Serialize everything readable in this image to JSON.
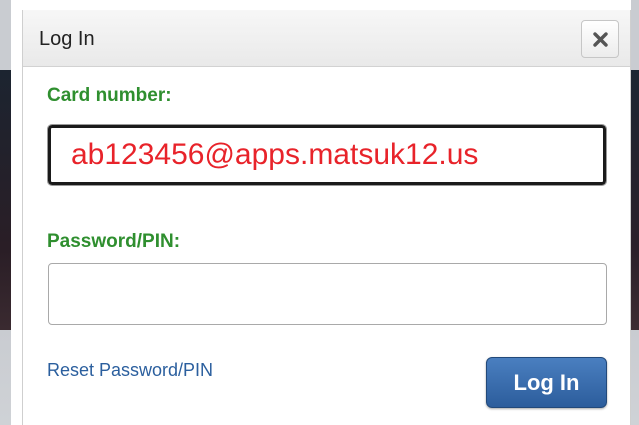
{
  "dialog": {
    "title": "Log In",
    "close_icon": "close-icon"
  },
  "form": {
    "card_label": "Card number:",
    "card_value": "ab123456@apps.matsuk12.us",
    "pin_label": "Password/PIN:",
    "pin_value": ""
  },
  "footer": {
    "reset_label": "Reset Password/PIN",
    "login_label": "Log In"
  },
  "colors": {
    "label_green": "#2f8f2f",
    "input_text_red": "#e8232a",
    "link_blue": "#2b5f9e",
    "button_blue": "#2c5d9c"
  }
}
